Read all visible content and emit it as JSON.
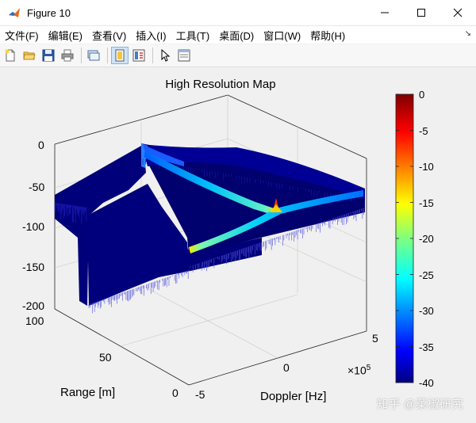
{
  "window": {
    "title": "Figure 10"
  },
  "menu": [
    {
      "name": "menu-file",
      "label": "文件(F)"
    },
    {
      "name": "menu-edit",
      "label": "编辑(E)"
    },
    {
      "name": "menu-view",
      "label": "查看(V)"
    },
    {
      "name": "menu-insert",
      "label": "插入(I)"
    },
    {
      "name": "menu-tools",
      "label": "工具(T)"
    },
    {
      "name": "menu-desktop",
      "label": "桌面(D)"
    },
    {
      "name": "menu-window",
      "label": "窗口(W)"
    },
    {
      "name": "menu-help",
      "label": "帮助(H)"
    }
  ],
  "toolbar_icons": [
    "new-figure-icon",
    "open-file-icon",
    "save-icon",
    "print-icon",
    "link-plot-icon",
    "hide-plot-tools-icon",
    "show-plot-tools-icon",
    "edit-plot-icon",
    "open-property-inspector-icon"
  ],
  "chart_data": {
    "type": "surface",
    "title": "High Resolution Map",
    "xlabel": "Doppler [Hz]",
    "ylabel": "Range [m]",
    "x_tick_labels": [
      "-5",
      "0",
      "5"
    ],
    "x_exponent": "×10",
    "x_exponent_power": "5",
    "x_range": [
      -500000,
      500000
    ],
    "y_tick_labels": [
      "0",
      "50",
      "100"
    ],
    "y_range": [
      0,
      100
    ],
    "z_tick_labels": [
      "0",
      "-50",
      "-100",
      "-150",
      "-200"
    ],
    "z_range": [
      -200,
      0
    ],
    "colorbar": {
      "tick_labels": [
        "0",
        "-5",
        "-10",
        "-15",
        "-20",
        "-25",
        "-30",
        "-35",
        "-40"
      ],
      "range": [
        -40,
        0
      ],
      "colormap": "jet"
    },
    "peak": {
      "doppler": 0,
      "range": 50,
      "value": 0
    },
    "grid": true,
    "view": "3d"
  },
  "watermark": "知乎 @菜椒研究"
}
